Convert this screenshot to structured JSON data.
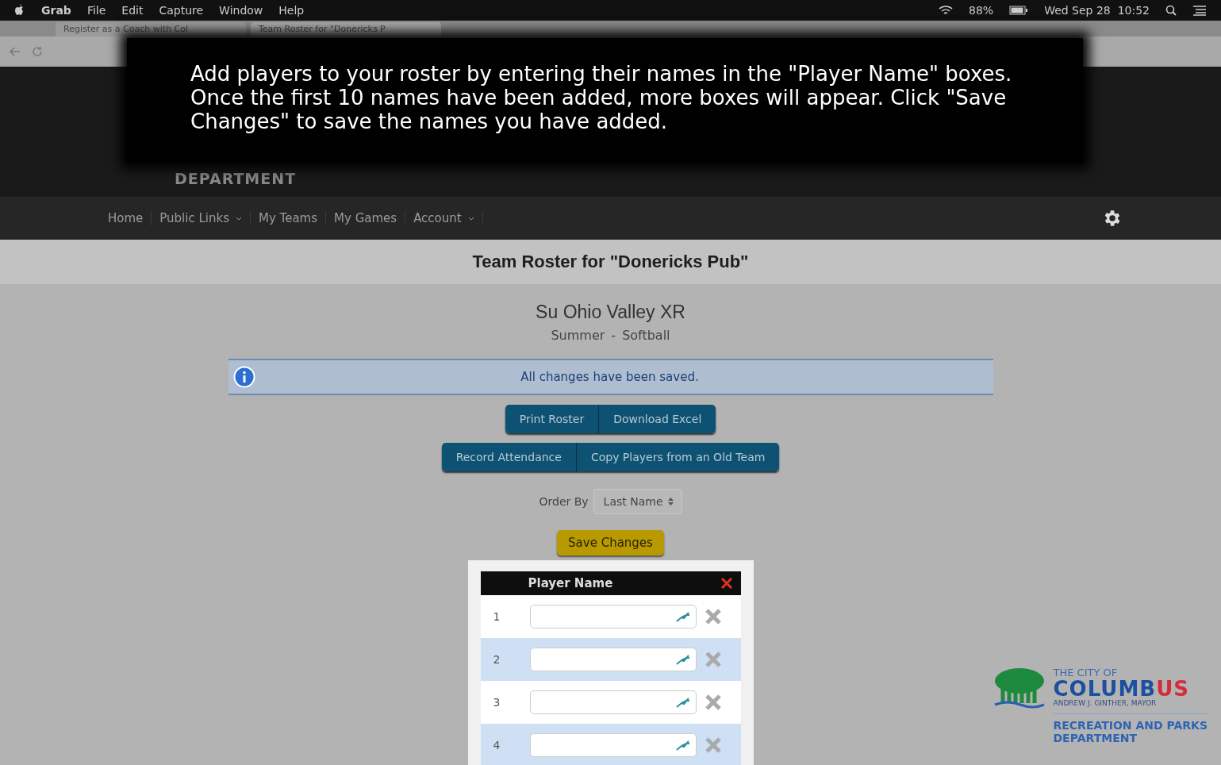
{
  "menubar": {
    "app": "Grab",
    "menus": [
      "File",
      "Edit",
      "Capture",
      "Window",
      "Help"
    ],
    "battery": "88%",
    "clock": "Wed Sep 28  10:52"
  },
  "browser_tabs": [
    {
      "title": "Register as a Coach with Col",
      "selected": false
    },
    {
      "title": "Team Roster for \"Donericks P",
      "selected": true
    }
  ],
  "tooltip": {
    "text": "Add players to your roster by entering their names in the \"Player Name\" boxes. Once the first 10 names have been added, more boxes will appear. Click \"Save Changes\" to save the names you have added."
  },
  "site_header": {
    "department": "DEPARTMENT"
  },
  "nav": [
    {
      "label": "Home",
      "dropdown": false
    },
    {
      "label": "Public Links",
      "dropdown": true
    },
    {
      "label": "My Teams",
      "dropdown": false
    },
    {
      "label": "My Games",
      "dropdown": false
    },
    {
      "label": "Account",
      "dropdown": true
    }
  ],
  "page_title": "Team Roster for \"Donericks Pub\"",
  "league": {
    "name": "Su Ohio Valley XR",
    "season": "Summer",
    "separator": "-",
    "sport": "Softball"
  },
  "alert": {
    "text": "All changes have been saved."
  },
  "button_groups": [
    [
      "Print Roster",
      "Download Excel"
    ],
    [
      "Record Attendance",
      "Copy Players from an Old Team"
    ]
  ],
  "order_by": {
    "label": "Order By",
    "value": "Last Name"
  },
  "save_button": "Save Changes",
  "roster": {
    "column": "Player Name",
    "rows": [
      {
        "number": "1"
      },
      {
        "number": "2"
      },
      {
        "number": "3"
      },
      {
        "number": "4"
      }
    ]
  },
  "footer_logo": {
    "line1": "THE CITY OF",
    "city_a": "COLUMB",
    "city_b": "US",
    "mayor": "ANDREW J. GINTHER, MAYOR",
    "dept_1": "RECREATION AND PARKS",
    "dept_2": "DEPARTMENT"
  }
}
